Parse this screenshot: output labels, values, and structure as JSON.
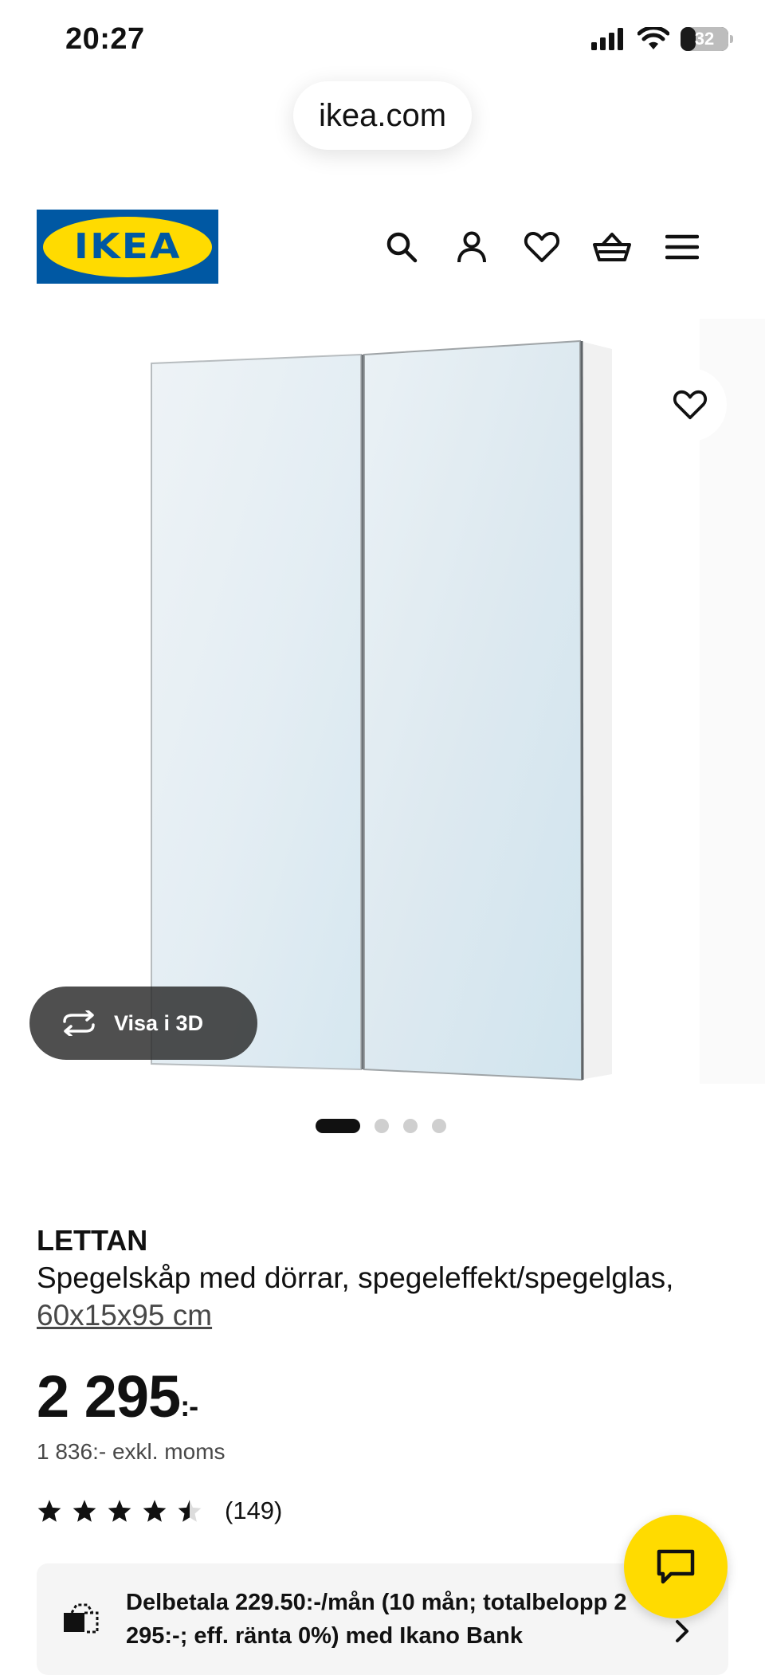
{
  "status_bar": {
    "time": "20:27",
    "battery": "32"
  },
  "browser": {
    "url": "ikea.com"
  },
  "header": {
    "logo_text": "IKEA",
    "icons": [
      "search-icon",
      "user-icon",
      "heart-icon",
      "basket-icon",
      "menu-icon"
    ]
  },
  "gallery": {
    "view_3d_label": "Visa i 3D",
    "slide_count": 4,
    "active_slide": 1
  },
  "product": {
    "name": "LETTAN",
    "description": "Spegelskåp med dörrar, spegeleffekt/spegelglas,",
    "size": "60x15x95 cm",
    "price": "2 295",
    "price_suffix": ":-",
    "excl_vat": "1 836:- exkl. moms",
    "rating": 4.5,
    "review_count": "(149)"
  },
  "installment": {
    "text": "Delbetala 229.50:-/mån (10 mån; totalbelopp 2 295:-; eff. ränta 0%) med Ikano Bank"
  },
  "colors": {
    "brand_blue": "#0058a3",
    "brand_yellow": "#ffdb00"
  }
}
